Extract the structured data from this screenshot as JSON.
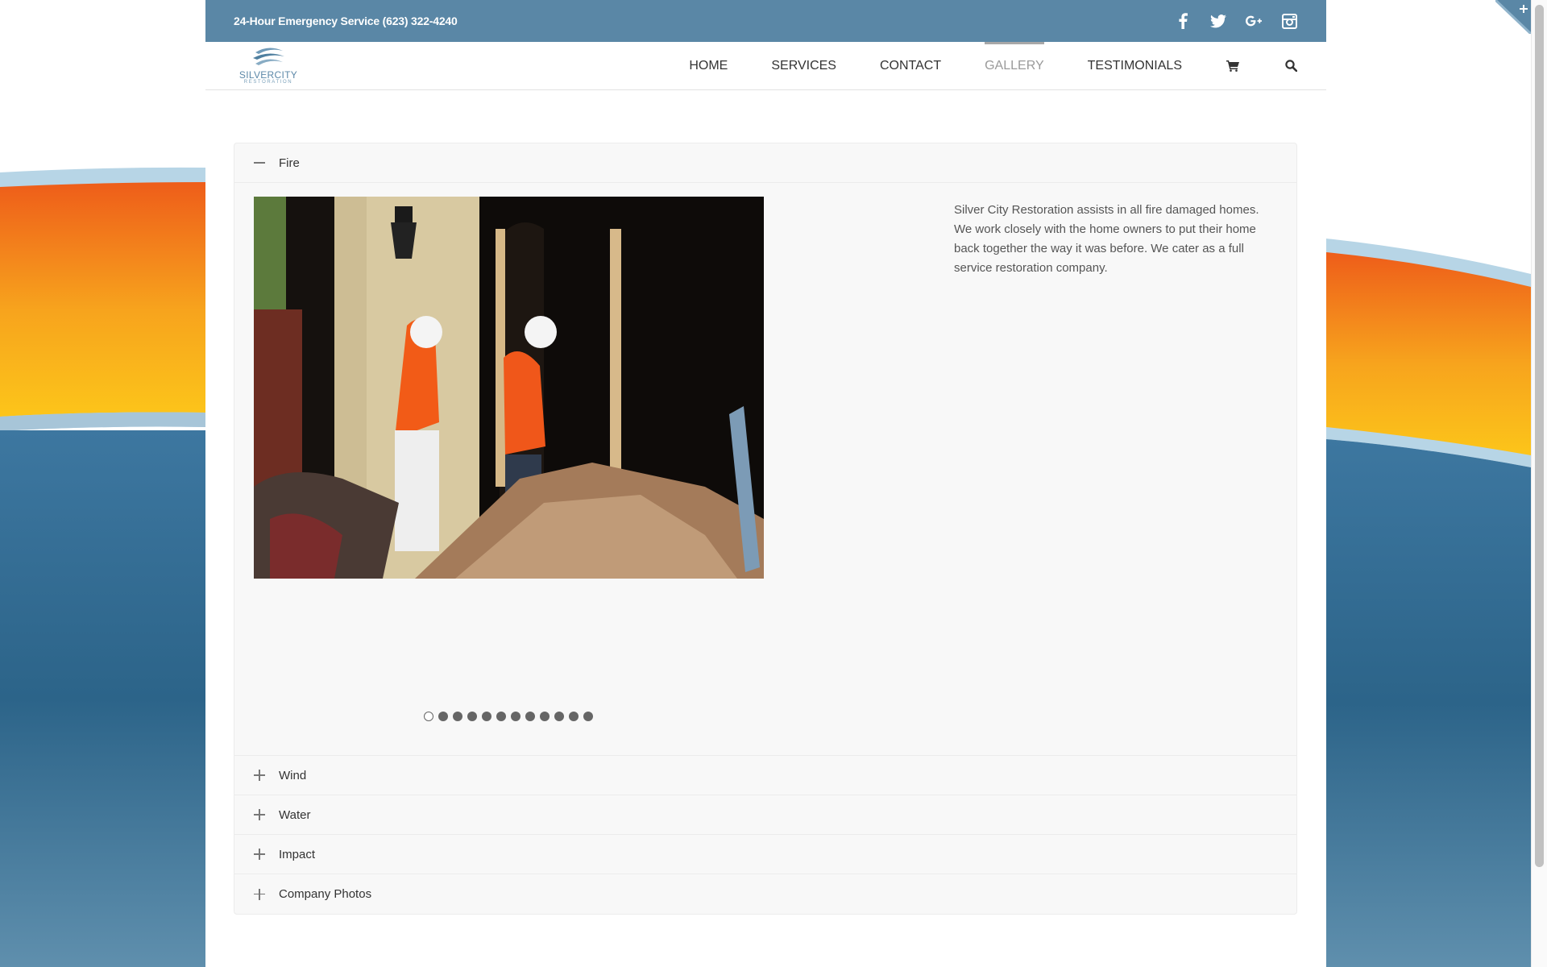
{
  "topbar": {
    "phone": "24-Hour Emergency Service (623) 322-4240",
    "social": [
      "facebook-icon",
      "twitter-icon",
      "google-plus-icon",
      "instagram-icon"
    ]
  },
  "logo": {
    "word": "SILVERCITY",
    "sub": "RESTORATION"
  },
  "nav": {
    "items": [
      {
        "label": "HOME",
        "active": false
      },
      {
        "label": "SERVICES",
        "active": false
      },
      {
        "label": "CONTACT",
        "active": false
      },
      {
        "label": "GALLERY",
        "active": true
      },
      {
        "label": "TESTIMONIALS",
        "active": false
      }
    ],
    "icons": [
      "cart-icon",
      "search-icon"
    ]
  },
  "accordion": {
    "open_panel": {
      "title": "Fire",
      "description": "Silver City Restoration assists in all fire damaged homes.  We work closely with the home owners to put their home back together the way it was before.  We cater as a full service restoration company.",
      "slider": {
        "total_slides": 12,
        "active_index": 1
      }
    },
    "panels": [
      "Wind",
      "Water",
      "Impact",
      "Company Photos"
    ]
  },
  "colors": {
    "topbar": "#5a87a6",
    "accent_orange": "#f07b1a",
    "accent_yellow": "#f8c21c",
    "band_blue": "#3b6f92"
  }
}
